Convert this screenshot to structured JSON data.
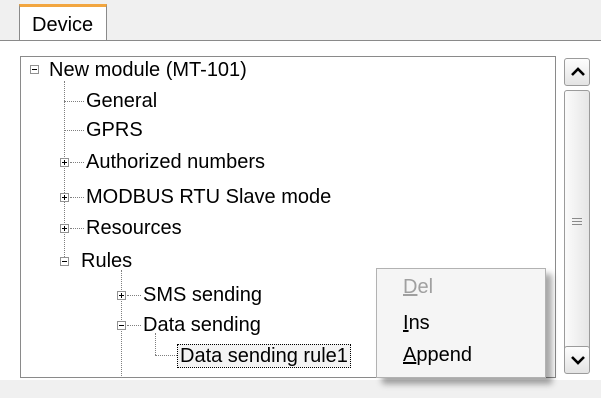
{
  "tabs": [
    {
      "label": "Device"
    }
  ],
  "tree": {
    "root": {
      "label": "New module  (MT-101)"
    },
    "items": [
      {
        "label": "General"
      },
      {
        "label": "GPRS"
      },
      {
        "label": "Authorized numbers"
      },
      {
        "label": "MODBUS RTU Slave mode"
      },
      {
        "label": "Resources"
      },
      {
        "label": "Rules"
      },
      {
        "label": "SMS sending"
      },
      {
        "label": "Data sending"
      },
      {
        "label": "Data sending rule1"
      }
    ]
  },
  "context_menu": {
    "items": [
      {
        "first": "D",
        "rest": "el",
        "enabled": false
      },
      {
        "first": "I",
        "rest": "ns",
        "enabled": true
      },
      {
        "first": "A",
        "rest": "ppend",
        "enabled": true
      }
    ]
  },
  "icons": {
    "collapse": "minus-box-icon",
    "expand": "plus-box-icon",
    "scroll_up": "chevron-up-icon",
    "scroll_down": "chevron-down-icon"
  }
}
